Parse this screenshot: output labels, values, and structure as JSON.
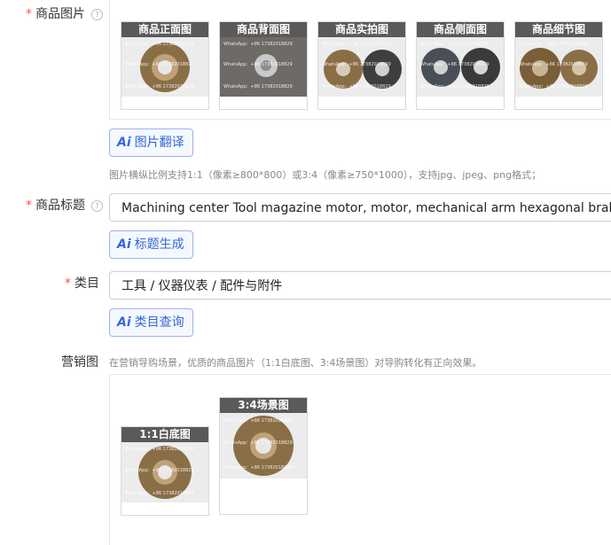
{
  "product_images": {
    "label": "商品图片",
    "required": "*",
    "help": "?",
    "thumbs": [
      {
        "caption": "商品正面图"
      },
      {
        "caption": "商品背面图"
      },
      {
        "caption": "商品实拍图"
      },
      {
        "caption": "商品侧面图"
      },
      {
        "caption": "商品细节图"
      }
    ],
    "translate_button": "图片翻译",
    "hint": "图片横纵比例支持1:1（像素≥800*800）或3:4（像素≥750*1000），支持jpg、jpeg、png格式；"
  },
  "product_title": {
    "label": "商品标题",
    "required": "*",
    "help": "?",
    "value": "Machining center Tool magazine motor, motor, mechanical arm hexagonal brake pads",
    "generate_button": "标题生成"
  },
  "category": {
    "label": "类目",
    "required": "*",
    "value": "工具 / 仪器仪表 / 配件与附件",
    "query_button": "类目查询"
  },
  "marketing_images": {
    "label": "营销图",
    "hint": "在营销导购场景，优质的商品图片（1:1白底图、3:4场景图）对导购转化有正向效果。",
    "thumbs": [
      {
        "caption": "1:1白底图"
      },
      {
        "caption": "3:4场景图"
      }
    ]
  },
  "ai_badge": "Ai",
  "watermark_text": "WhatsApp：+86 17382018829",
  "colors": {
    "accent": "#3468d6",
    "required": "#ff4d4f",
    "caption_bg": "#5a5a5a",
    "disc": "#8a6e45"
  },
  "icons": [
    "question-circle-icon",
    "ai-icon"
  ]
}
